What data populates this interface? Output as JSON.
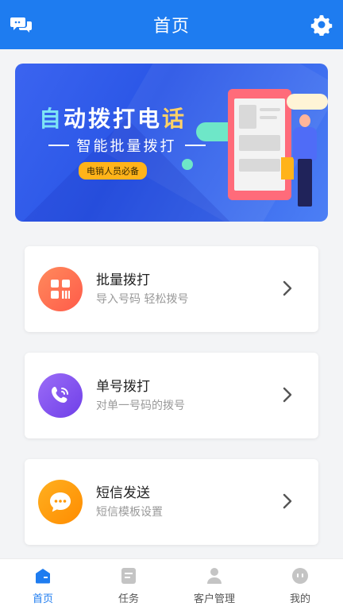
{
  "header": {
    "title": "首页",
    "left_icon": "chat-bubbles-icon",
    "right_icon": "gear-icon"
  },
  "banner": {
    "title_part1": "自",
    "title_part2": "动拨打电",
    "title_part3": "话",
    "subtitle": "智能批量拨打",
    "tag": "电销人员必备"
  },
  "cards": [
    {
      "title": "批量拨打",
      "subtitle": "导入号码 轻松拨号",
      "icon": "grid-icon",
      "color": "#ff6b4a"
    },
    {
      "title": "单号拨打",
      "subtitle": "对单一号码的拨号",
      "icon": "phone-icon",
      "color": "#7b4cf0"
    },
    {
      "title": "短信发送",
      "subtitle": "短信模板设置",
      "icon": "message-icon",
      "color": "#ff9800"
    }
  ],
  "tabbar": {
    "tabs": [
      {
        "label": "首页",
        "icon": "home-icon",
        "active": true
      },
      {
        "label": "任务",
        "icon": "task-icon",
        "active": false
      },
      {
        "label": "客户管理",
        "icon": "customer-icon",
        "active": false
      },
      {
        "label": "我的",
        "icon": "profile-icon",
        "active": false
      }
    ]
  },
  "colors": {
    "primary": "#1e7cf0",
    "background": "#f3f4f6"
  }
}
